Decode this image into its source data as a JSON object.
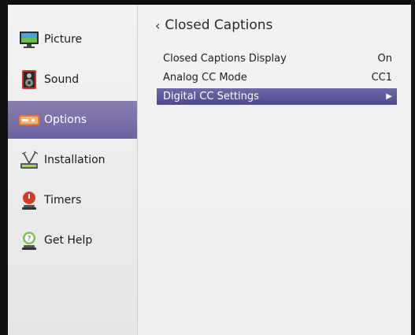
{
  "sidebar": {
    "items": [
      {
        "label": "Picture",
        "icon": "monitor-icon"
      },
      {
        "label": "Sound",
        "icon": "speaker-icon"
      },
      {
        "label": "Options",
        "icon": "options-icon",
        "selected": true
      },
      {
        "label": "Installation",
        "icon": "antenna-icon"
      },
      {
        "label": "Timers",
        "icon": "timer-icon"
      },
      {
        "label": "Get Help",
        "icon": "help-icon"
      }
    ]
  },
  "main": {
    "back_glyph": "‹",
    "title": "Closed Captions",
    "rows": [
      {
        "label": "Closed Captions Display",
        "value": "On"
      },
      {
        "label": "Analog CC Mode",
        "value": "CC1"
      },
      {
        "label": "Digital CC Settings",
        "value": "▶",
        "highlighted": true
      }
    ]
  },
  "colors": {
    "selected_bg": "#7a6fa8",
    "highlight_bg": "#5a55a0"
  }
}
